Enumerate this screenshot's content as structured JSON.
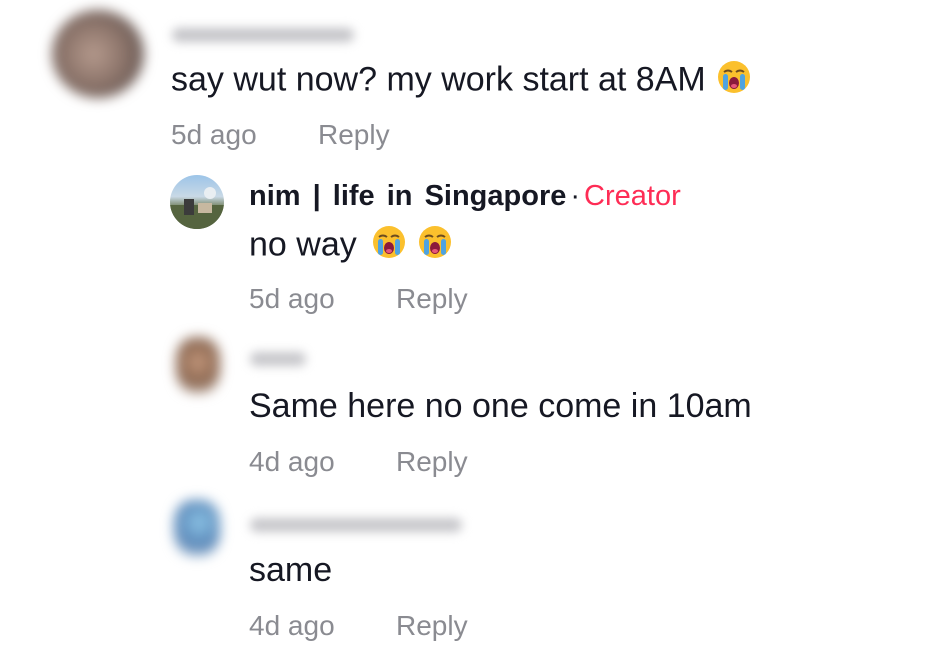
{
  "comments": [
    {
      "text": "say wut now? my work start at 8AM",
      "time": "5d ago",
      "reply_label": "Reply"
    },
    {
      "author": "nim | life in Singapore",
      "separator": "·",
      "badge": "Creator",
      "text": "no way",
      "time": "5d ago",
      "reply_label": "Reply"
    },
    {
      "text": "Same here no one come in 10am",
      "time": "4d ago",
      "reply_label": "Reply"
    },
    {
      "text": "same",
      "time": "4d ago",
      "reply_label": "Reply"
    }
  ],
  "icons": {
    "emoji": "loudly-crying-face-icon"
  },
  "colors": {
    "text": "#161823",
    "meta": "#8a8b91",
    "creator_badge": "#fe2c55"
  }
}
